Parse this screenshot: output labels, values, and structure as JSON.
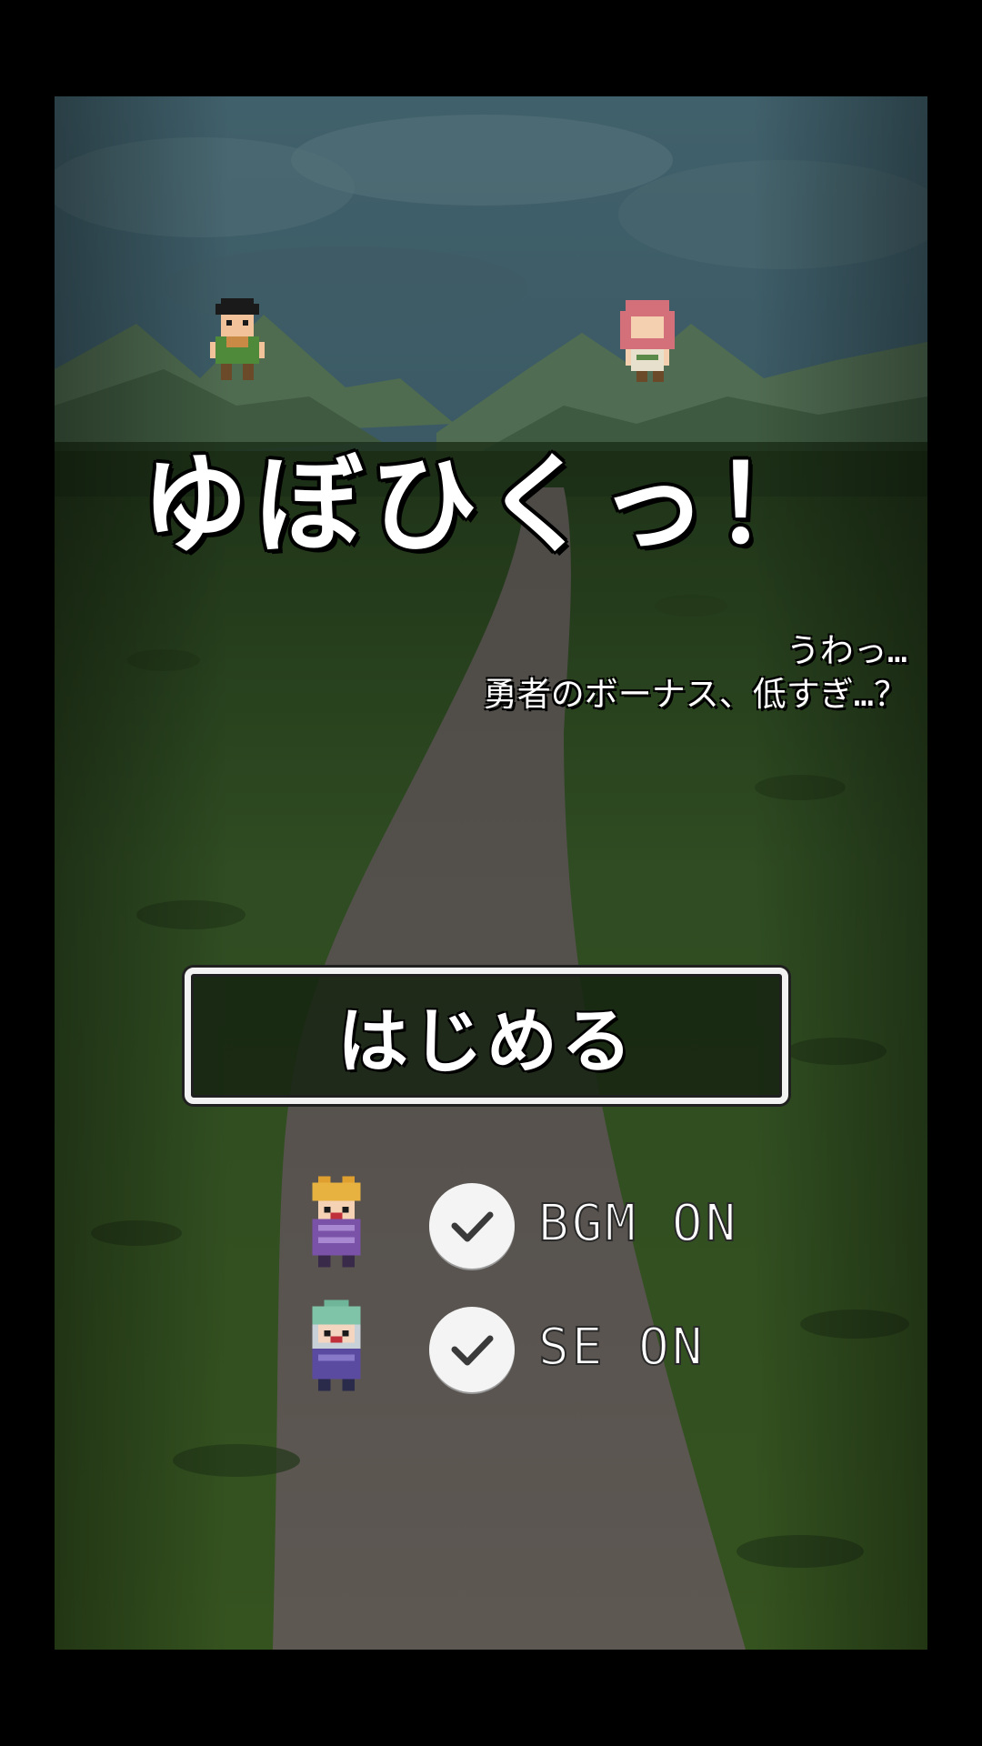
{
  "game": {
    "title": "ゆぼひくっ！",
    "tagline": [
      "うわっ…",
      "勇者のボーナス、低すぎ…？"
    ],
    "start_label": "はじめる"
  },
  "options": [
    {
      "id": "bgm",
      "label": "BGM ON",
      "checked": true,
      "avatar": "purple-hero-sprite-icon"
    },
    {
      "id": "se",
      "label": "SE ON",
      "checked": true,
      "avatar": "green-hood-mage-sprite-icon"
    }
  ],
  "sprites": [
    {
      "name": "villager-boy-sprite-icon"
    },
    {
      "name": "pink-hair-girl-sprite-icon"
    }
  ],
  "colors": {
    "sky": "#33505c",
    "grass": "#2d4a22",
    "path": "#5b5651",
    "text": "#ffffff",
    "check_bg": "#f4f4f4",
    "check_mark": "#3a3a3a"
  }
}
